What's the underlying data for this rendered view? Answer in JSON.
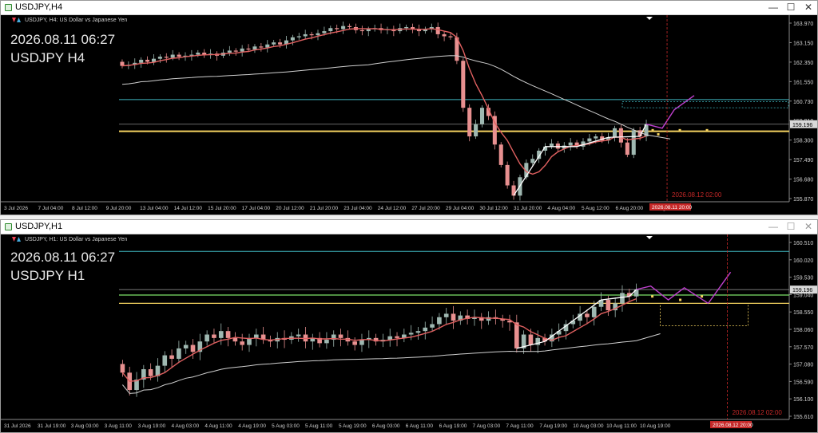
{
  "colors": {
    "up": "#9fb8b1",
    "down": "#e89090",
    "ma_fast": "#e06060",
    "ma_slow": "#cfcfcf",
    "yellow": "#f4d25f",
    "cyan": "#3fb7c0",
    "magenta": "#c040d0",
    "pattern": "#ffffff",
    "green_level": "#7de36a",
    "date_line": "#c62828"
  },
  "windows": [
    {
      "id": "h4",
      "title": "USDJPY,H4",
      "symbol_line": "USDJPY, H4:  US Dollar vs Japanese Yen",
      "overlay_datetime": "2026.08.11 06:27",
      "overlay_symbol": "USDJPY H4",
      "price_axis": [
        "163.970",
        "163.150",
        "162.350",
        "161.550",
        "160.730",
        "159.910",
        "159.196",
        "158.300",
        "157.490",
        "156.680",
        "155.870"
      ],
      "current_price": "159.196",
      "time_axis": [
        "3 Jul 2026",
        "7 Jul 04:00",
        "8 Jul 12:00",
        "9 Jul 20:00",
        "13 Jul 04:00",
        "14 Jul 12:00",
        "15 Jul 20:00",
        "17 Jul 04:00",
        "20 Jul 12:00",
        "21 Jul 20:00",
        "23 Jul 04:00",
        "24 Jul 12:00",
        "27 Jul 20:00",
        "29 Jul 04:00",
        "30 Jul 12:00",
        "31 Jul 20:00",
        "4 Aug 04:00",
        "5 Aug 12:00",
        "6 Aug 20:00",
        "10 Aug 04:00"
      ],
      "future_date_label": "2026.08.12 02:00",
      "axis_date_label": "2026.08.11 20:00"
    },
    {
      "id": "h1",
      "title": "USDJPY,H1",
      "symbol_line": "USDJPY, H1:  US Dollar vs Japanese Yen",
      "overlay_datetime": "2026.08.11 06:27",
      "overlay_symbol": "USDJPY H1",
      "price_axis": [
        "160.510",
        "160.020",
        "159.530",
        "159.196",
        "159.040",
        "158.550",
        "158.060",
        "157.570",
        "157.080",
        "156.590",
        "156.100",
        "155.610"
      ],
      "current_price": "159.196",
      "time_axis": [
        "31 Jul 2026",
        "31 Jul 19:00",
        "3 Aug 03:00",
        "3 Aug 11:00",
        "3 Aug 19:00",
        "4 Aug 03:00",
        "4 Aug 11:00",
        "4 Aug 19:00",
        "5 Aug 03:00",
        "5 Aug 11:00",
        "5 Aug 19:00",
        "6 Aug 03:00",
        "6 Aug 11:00",
        "6 Aug 19:00",
        "7 Aug 03:00",
        "7 Aug 11:00",
        "7 Aug 19:00",
        "10 Aug 03:00",
        "10 Aug 11:00",
        "10 Aug 19:00"
      ],
      "future_date_label": "2026.08.12 02:00",
      "axis_date_label": "2026.08.12 20:00"
    }
  ],
  "chart_data": [
    {
      "type": "candlestick",
      "symbol": "USDJPY",
      "timeframe": "H4",
      "ylim": [
        155.4,
        164.3
      ],
      "closes": [
        162.05,
        162.1,
        162.2,
        162.35,
        162.25,
        162.4,
        162.5,
        162.45,
        162.6,
        162.5,
        162.55,
        162.6,
        162.7,
        162.6,
        162.65,
        162.55,
        162.7,
        162.8,
        162.75,
        162.9,
        162.85,
        163.0,
        162.95,
        163.1,
        163.2,
        163.1,
        163.3,
        163.45,
        163.5,
        163.6,
        163.55,
        163.65,
        163.75,
        163.9,
        163.85,
        164.0,
        163.95,
        163.8,
        163.75,
        163.85,
        163.9,
        163.8,
        163.85,
        163.75,
        163.9,
        163.95,
        163.85,
        163.75,
        163.85,
        163.95,
        163.6,
        163.5,
        163.45,
        162.3,
        160.0,
        158.6,
        159.2,
        160.0,
        159.6,
        158.2,
        157.2,
        156.2,
        155.7,
        156.6,
        157.3,
        157.5,
        157.9,
        158.1,
        158.25,
        158.0,
        158.15,
        158.3,
        158.1,
        158.35,
        158.5,
        158.6,
        158.4,
        158.55,
        159.0,
        158.3,
        157.7,
        158.9,
        158.6,
        159.2
      ],
      "levels": {
        "current": 159.196,
        "yellow_support": 158.85,
        "cyan_resistance": 160.4,
        "projection_zone": [
          160.0,
          160.3
        ]
      }
    },
    {
      "type": "candlestick",
      "symbol": "USDJPY",
      "timeframe": "H1",
      "ylim": [
        155.45,
        160.65
      ],
      "closes": [
        156.8,
        156.3,
        156.6,
        156.9,
        156.7,
        157.0,
        157.3,
        157.2,
        157.5,
        157.6,
        157.4,
        157.7,
        157.9,
        157.8,
        158.0,
        157.8,
        157.7,
        157.6,
        157.8,
        157.9,
        157.75,
        157.7,
        157.8,
        157.75,
        157.85,
        157.9,
        157.7,
        157.8,
        157.65,
        157.75,
        157.9,
        157.8,
        157.7,
        157.6,
        157.75,
        157.8,
        157.7,
        157.75,
        157.85,
        157.8,
        157.9,
        157.95,
        158.0,
        158.1,
        158.2,
        158.4,
        158.5,
        158.3,
        158.45,
        158.35,
        158.4,
        158.3,
        158.4,
        158.35,
        158.3,
        158.25,
        157.5,
        157.9,
        157.6,
        157.8,
        157.7,
        157.9,
        158.0,
        158.2,
        158.3,
        158.5,
        158.4,
        158.7,
        158.9,
        158.6,
        158.8,
        159.1,
        159.0,
        159.2
      ],
      "levels": {
        "current": 159.196,
        "green_level": 159.04,
        "yellow_support": 158.8,
        "cyan_resistance": 160.3,
        "projection_zone": [
          158.15,
          158.8
        ]
      }
    }
  ]
}
